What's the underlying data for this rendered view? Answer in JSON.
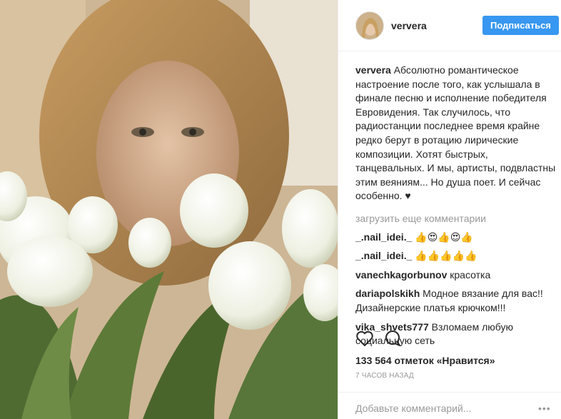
{
  "post": {
    "author": "ververa",
    "follow_label": "Подписаться",
    "caption_user": "ververa",
    "caption_text": "Абсолютно романтическое настроение после того, как услышала в финале песню и исполнение победителя Евровидения. Так случилось, что радиостанции последнее время крайне редко берут в ротацию лирические композиции. Хотят быстрых, танцевальных. И мы, артисты, подвластны этим веяниям... Но душа поет. И сейчас особенно. ♥",
    "load_more": "загрузить еще комментарии",
    "comments": [
      {
        "user": "_.nail_idei._",
        "text": "👍😍👍😍👍"
      },
      {
        "user": "_.nail_idei._",
        "text": "👍👍👍👍👍"
      },
      {
        "user": "vanechkagorbunov",
        "text": "красотка"
      },
      {
        "user": "dariapolskikh",
        "text": "Модное вязание для вас!! Дизайнерские платья крючком!!!"
      },
      {
        "user": "vika_shvets777",
        "text": "Взломаем любую социальную сеть"
      }
    ],
    "likes": "133 564 отметок «Нравится»",
    "time": "7 ЧАСОВ НАЗАД",
    "comment_placeholder": "Добавьте комментарий...",
    "more_options": "•••"
  },
  "icons": {
    "like": "heart-icon",
    "comment": "speech-bubble-icon",
    "more": "ellipsis-icon"
  },
  "colors": {
    "accent": "#3897f0",
    "text": "#262626",
    "muted": "#999999",
    "divider": "#efefef"
  }
}
